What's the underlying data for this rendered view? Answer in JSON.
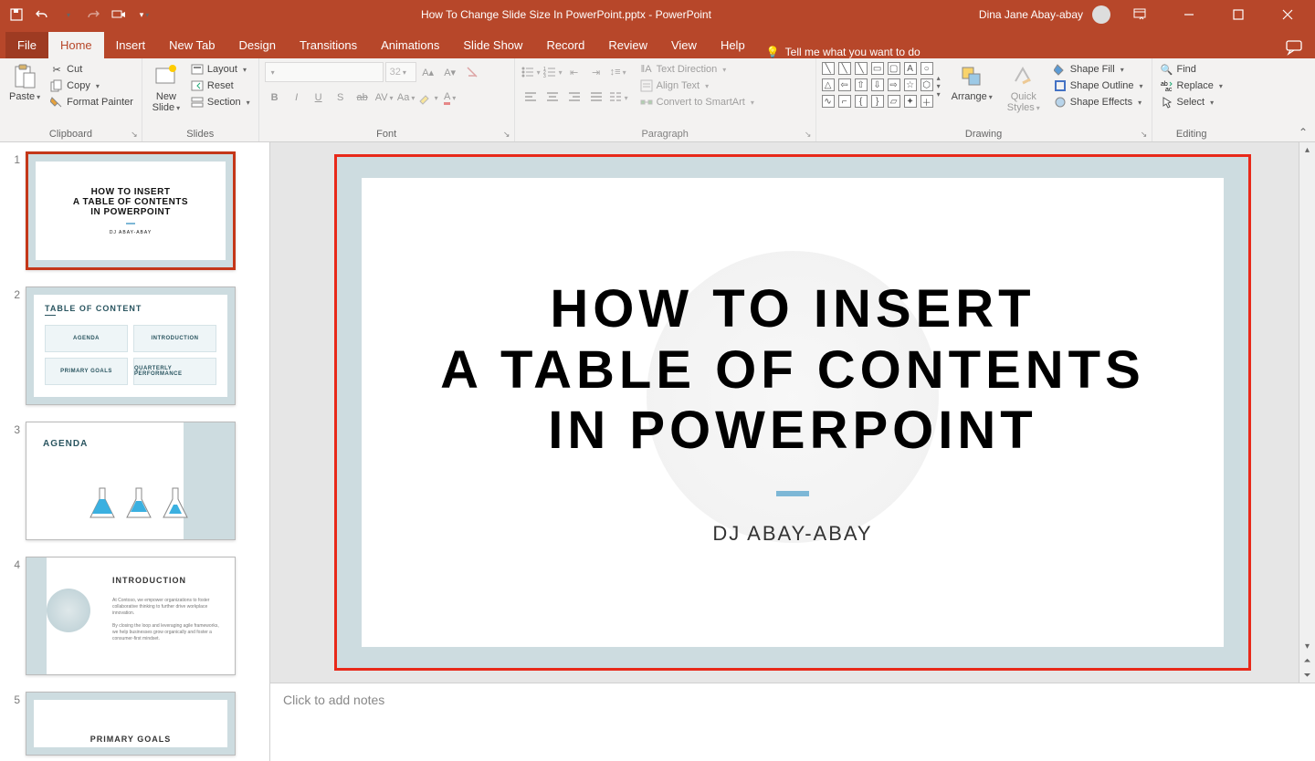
{
  "titlebar": {
    "doc_title": "How To Change Slide Size In PowerPoint.pptx",
    "app_sep": "  -  ",
    "app_name": "PowerPoint",
    "user_name": "Dina Jane Abay-abay"
  },
  "tabs": {
    "file": "File",
    "items": [
      "Home",
      "Insert",
      "New Tab",
      "Design",
      "Transitions",
      "Animations",
      "Slide Show",
      "Record",
      "Review",
      "View",
      "Help"
    ],
    "active": "Home",
    "tellme": "Tell me what you want to do"
  },
  "ribbon": {
    "clipboard": {
      "label": "Clipboard",
      "paste": "Paste",
      "cut": "Cut",
      "copy": "Copy",
      "format_painter": "Format Painter"
    },
    "slides": {
      "label": "Slides",
      "new_slide": "New\nSlide",
      "layout": "Layout",
      "reset": "Reset",
      "section": "Section"
    },
    "font": {
      "label": "Font",
      "size_value": "32"
    },
    "paragraph": {
      "label": "Paragraph",
      "text_direction": "Text Direction",
      "align_text": "Align Text",
      "convert_smartart": "Convert to SmartArt"
    },
    "drawing": {
      "label": "Drawing",
      "arrange": "Arrange",
      "quick_styles": "Quick\nStyles",
      "shape_fill": "Shape Fill",
      "shape_outline": "Shape Outline",
      "shape_effects": "Shape Effects"
    },
    "editing": {
      "label": "Editing",
      "find": "Find",
      "replace": "Replace",
      "select": "Select"
    }
  },
  "thumbs": [
    {
      "num": "1",
      "title1": "HOW TO INSERT",
      "title2": "A TABLE OF CONTENTS",
      "title3": "IN POWERPOINT",
      "sub": "DJ ABAY-ABAY"
    },
    {
      "num": "2",
      "title": "TABLE OF CONTENT",
      "c1": "AGENDA",
      "c2": "INTRODUCTION",
      "c3": "PRIMARY GOALS",
      "c4": "QUARTERLY PERFORMANCE"
    },
    {
      "num": "3",
      "title": "AGENDA"
    },
    {
      "num": "4",
      "title": "INTRODUCTION",
      "p1": "At Contoso, we empower organizations to foster collaborative thinking to further drive workplace innovation.",
      "p2": "By closing the loop and leveraging agile frameworks, we help businesses grow organically and foster a consumer-first mindset."
    },
    {
      "num": "5",
      "title": "PRIMARY GOALS"
    }
  ],
  "main_slide": {
    "line1": "HOW TO INSERT",
    "line2": "A TABLE OF CONTENTS",
    "line3": "IN POWERPOINT",
    "author": "DJ ABAY-ABAY"
  },
  "notes": {
    "placeholder": "Click to add notes"
  }
}
